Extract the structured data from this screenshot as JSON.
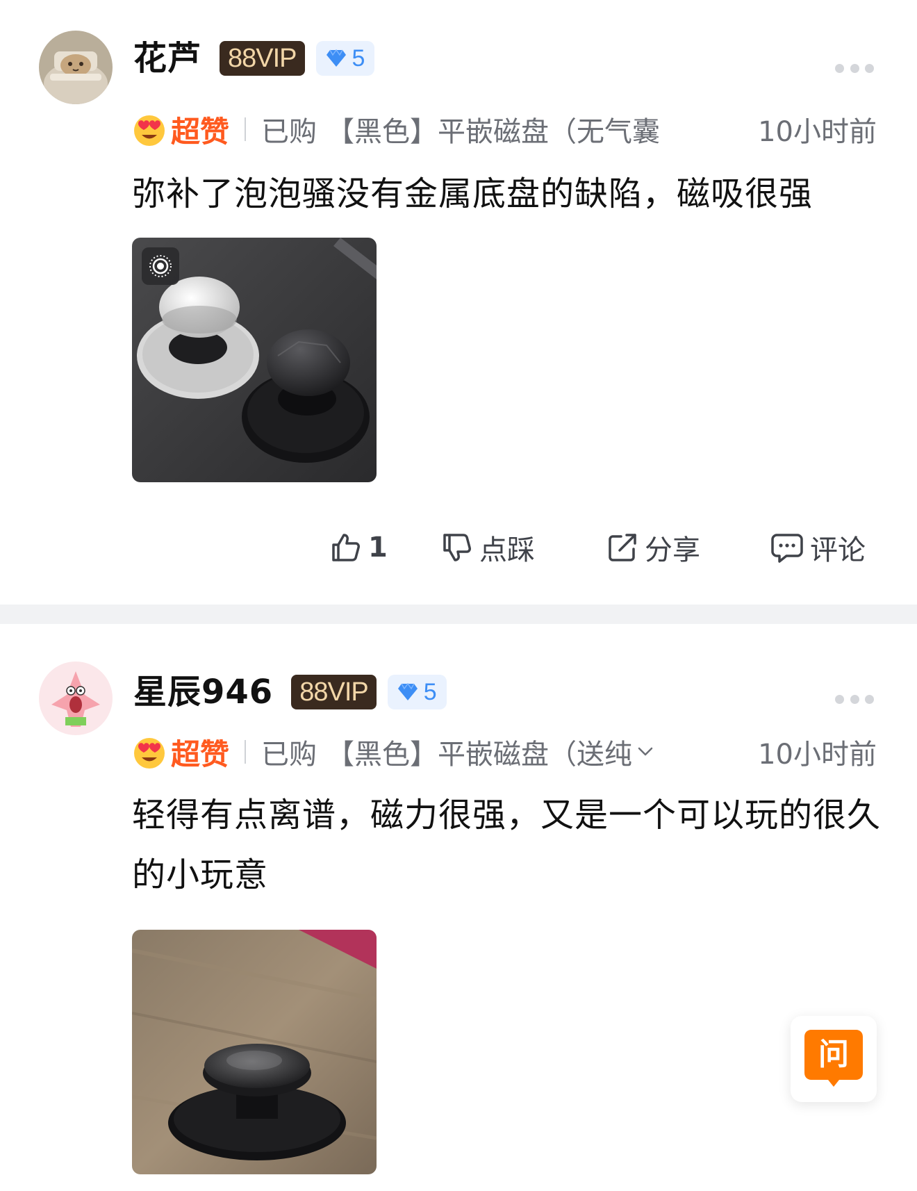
{
  "reviews": [
    {
      "username": "花芦",
      "vip_badge": "88VIP",
      "level": "5",
      "rating_label": "超赞",
      "purchased_label": "已购",
      "sku": "【黑色】平嵌磁盘（无气囊",
      "timestamp": "10小时前",
      "text": "弥补了泡泡骚没有金属底盘的缺陷，磁吸很强",
      "actions": {
        "like_count": "1",
        "dislike_label": "点踩",
        "share_label": "分享",
        "comment_label": "评论"
      }
    },
    {
      "username": "星辰946",
      "vip_badge": "88VIP",
      "level": "5",
      "rating_label": "超赞",
      "purchased_label": "已购",
      "sku": "【黑色】平嵌磁盘（送纯",
      "timestamp": "10小时前",
      "text": "轻得有点离谱，磁力很强，又是一个可以玩的很久的小玩意"
    }
  ],
  "ask_button_label": "问",
  "colors": {
    "rating_orange": "#ff5a1f",
    "vip_background": "#3a2a1f",
    "vip_text": "#f2d6a8",
    "level_blue": "#3d8ef5",
    "level_background": "#eaf2fe",
    "ask_orange": "#ff7a00",
    "meta_gray": "#6b6e75"
  },
  "icons": {
    "rating": "heart-eyes-emoji-icon",
    "level": "diamond-icon",
    "more": "more-dots-icon",
    "like": "thumbs-up-icon",
    "dislike": "thumbs-down-icon",
    "share": "share-icon",
    "comment": "comment-icon",
    "expand": "chevron-down-icon",
    "photo_marker": "live-photo-icon"
  }
}
